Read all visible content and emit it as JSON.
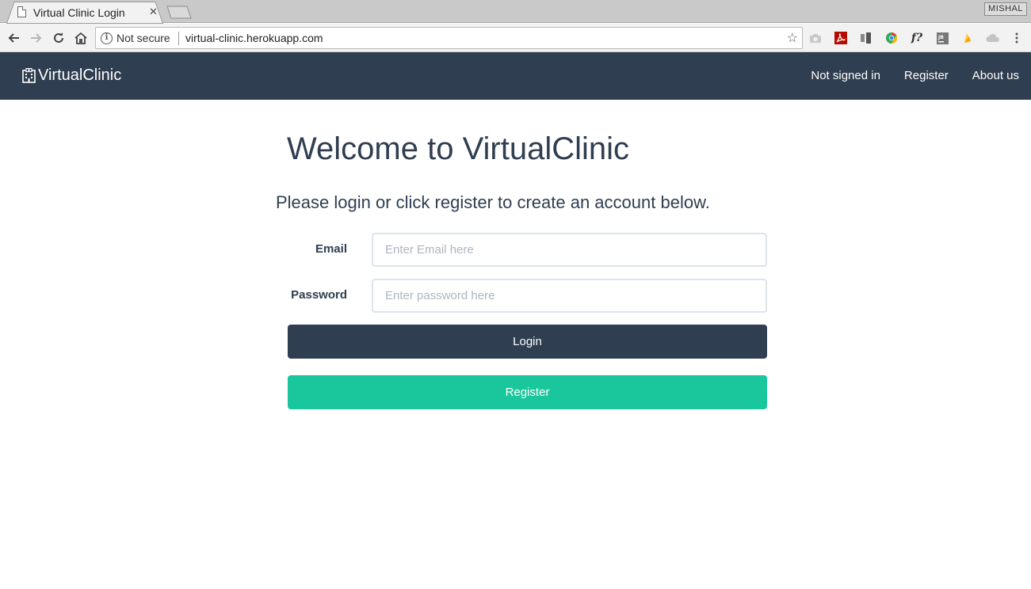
{
  "browser": {
    "tab_title": "Virtual Clinic Login",
    "tab_close": "✕",
    "profile_name": "MISHAL",
    "security_label": "Not secure",
    "url": "virtual-clinic.herokuapp.com"
  },
  "navbar": {
    "brand": "VirtualClinic",
    "links": [
      "Not signed in",
      "Register",
      "About us"
    ]
  },
  "main": {
    "title": "Welcome to VirtualClinic",
    "subtitle": "Please login or click register to create an account below.",
    "email_label": "Email",
    "email_placeholder": "Enter Email here",
    "password_label": "Password",
    "password_placeholder": "Enter password here",
    "login_button": "Login",
    "register_button": "Register"
  },
  "colors": {
    "navbar": "#2f3e50",
    "accent": "#1ac69c",
    "input_border": "#dce4ec"
  },
  "icons": [
    "page-icon",
    "back-arrow-icon",
    "forward-arrow-icon",
    "reload-icon",
    "home-icon",
    "info-icon",
    "star-icon",
    "camera-icon",
    "pdf-icon",
    "columns-icon",
    "chrome-icon",
    "font-icon",
    "jetbrains-icon",
    "flame-icon",
    "cloud-icon",
    "menu-dots-icon",
    "hospital-icon"
  ]
}
